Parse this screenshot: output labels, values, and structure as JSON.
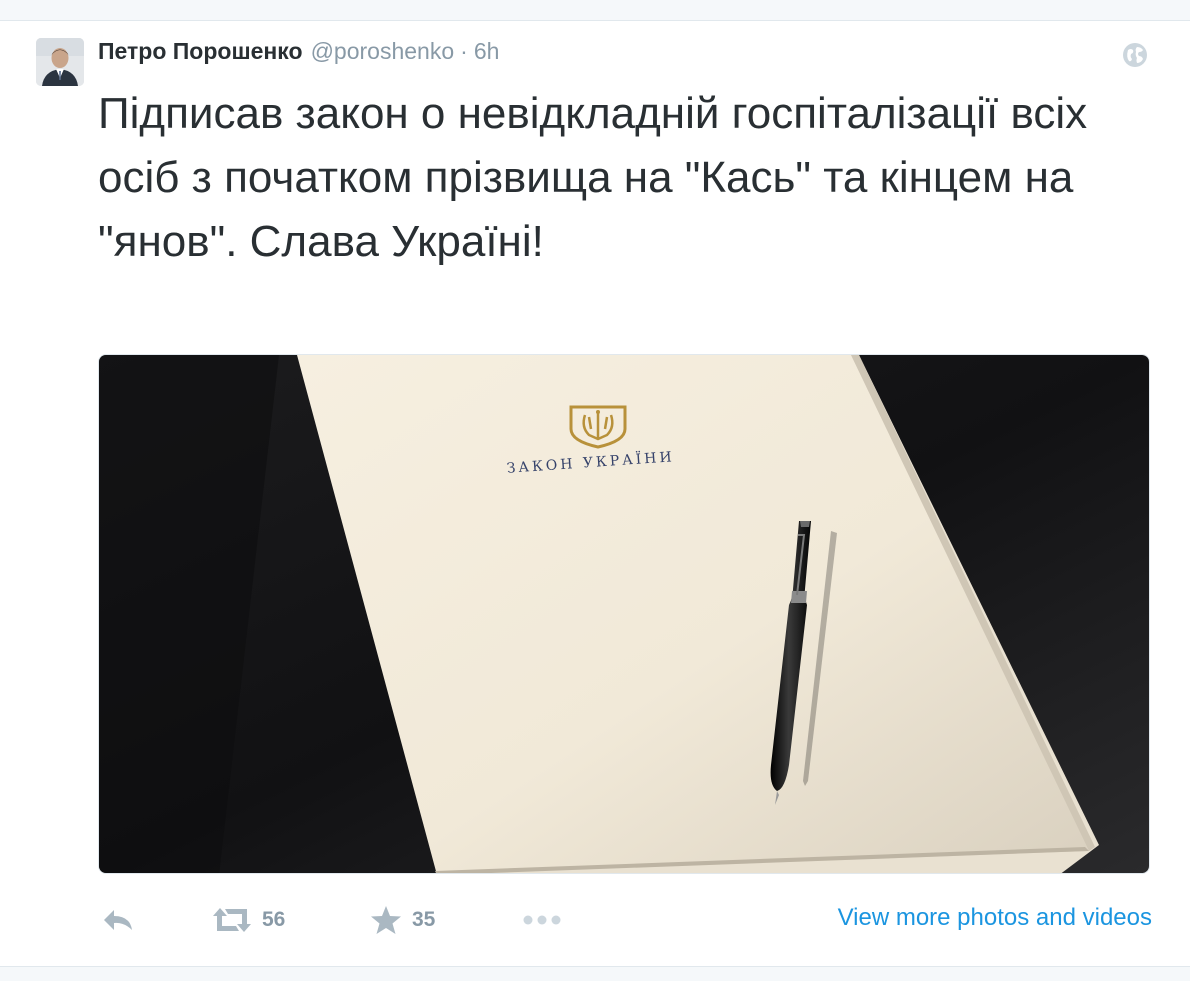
{
  "tweet": {
    "fullname": "Петро Порошенко",
    "username": "@poroshenko",
    "separator": "·",
    "time": "6h",
    "text": "Підписав закон о невідкладній госпіталізації всіх осіб з початком прізвища на \"Кась\" та кінцем на \"янов\". Слава Україні!",
    "media": {
      "document_title": "ЗАКОН УКРАЇНИ",
      "emblem": "trident-emblem-icon"
    },
    "actions": {
      "reply_icon": "reply-icon",
      "retweet_icon": "retweet-icon",
      "retweet_count": "56",
      "favorite_icon": "star-icon",
      "favorite_count": "35",
      "more_icon": "more-dots-icon",
      "view_more_label": "View more photos and videos"
    }
  },
  "colors": {
    "link": "#1b95e0",
    "text": "#292f33",
    "muted": "#8899a6",
    "icon": "#aab8c2"
  }
}
